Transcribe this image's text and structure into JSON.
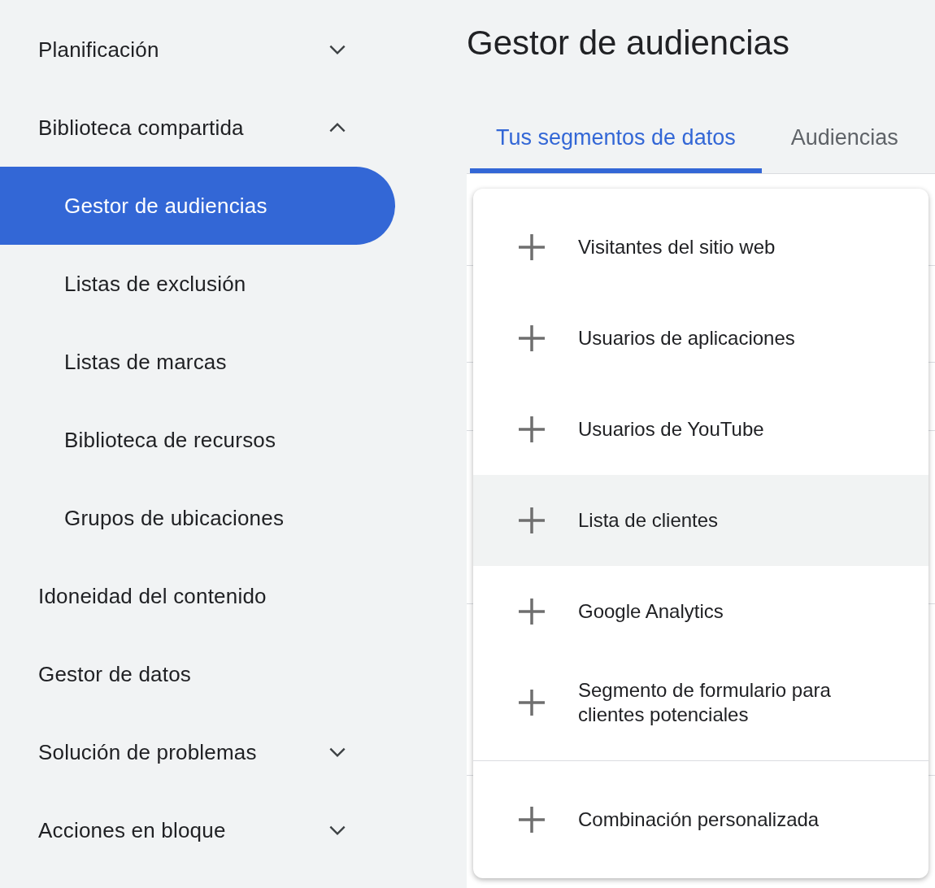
{
  "sidebar": {
    "items": [
      {
        "label": "Planificación",
        "kind": "section",
        "expanded": false,
        "selected": false
      },
      {
        "label": "Biblioteca compartida",
        "kind": "section",
        "expanded": true,
        "selected": false,
        "children": [
          {
            "label": "Gestor de audiencias",
            "selected": true
          },
          {
            "label": "Listas de exclusión",
            "selected": false
          },
          {
            "label": "Listas de marcas",
            "selected": false
          },
          {
            "label": "Biblioteca de recursos",
            "selected": false
          },
          {
            "label": "Grupos de ubicaciones",
            "selected": false
          }
        ]
      },
      {
        "label": "Idoneidad del contenido",
        "kind": "link",
        "selected": false
      },
      {
        "label": "Gestor de datos",
        "kind": "link",
        "selected": false
      },
      {
        "label": "Solución de problemas",
        "kind": "section",
        "expanded": false,
        "selected": false
      },
      {
        "label": "Acciones en bloque",
        "kind": "section",
        "expanded": false,
        "selected": false
      }
    ]
  },
  "page_title": "Gestor de audiencias",
  "tabs": [
    {
      "label": "Tus segmentos de datos",
      "selected": true
    },
    {
      "label": "Audiencias",
      "selected": false
    }
  ],
  "menu": {
    "items": [
      {
        "label": "Visitantes del sitio web",
        "highlighted": false,
        "divider_before": false
      },
      {
        "label": "Usuarios de aplicaciones",
        "highlighted": false,
        "divider_before": false
      },
      {
        "label": "Usuarios de YouTube",
        "highlighted": false,
        "divider_before": false
      },
      {
        "label": "Lista de clientes",
        "highlighted": true,
        "divider_before": false
      },
      {
        "label": "Google Analytics",
        "highlighted": false,
        "divider_before": false
      },
      {
        "label": "Segmento de formulario para clientes potenciales",
        "highlighted": false,
        "divider_before": false
      },
      {
        "label": "Combinación personalizada",
        "highlighted": false,
        "divider_before": true
      }
    ]
  }
}
